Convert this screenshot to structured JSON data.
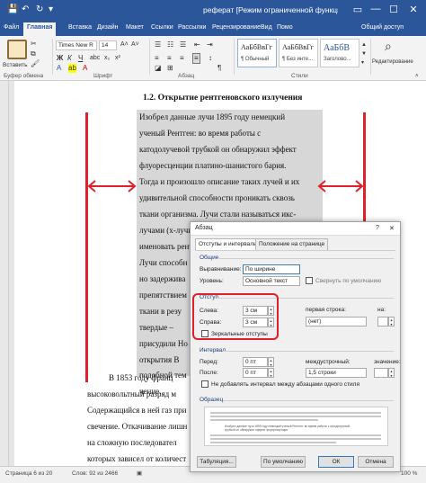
{
  "titlebar": {
    "title": "реферат [Режим ограниченной функциональност...",
    "qa_save": "💾",
    "qa_undo": "↶",
    "qa_redo": "↻",
    "qa_more": "▾",
    "win_restore": "▭",
    "win_minimize": "—",
    "win_maximize": "☐",
    "win_close": "✕"
  },
  "tabs": [
    "Файл",
    "Главная",
    "Вставка",
    "Дизайн",
    "Макет",
    "Ссылки",
    "Рассылки",
    "Рецензирование",
    "Вид"
  ],
  "tab_help": "Помо",
  "share": "Общий доступ",
  "ribbon": {
    "paste": "Вставить",
    "font_name": "Times New R",
    "font_size": "14",
    "bold": "Ж",
    "italic": "К",
    "underline": "Ч",
    "groups": {
      "clipboard": "Буфер обмена",
      "font": "Шрифт",
      "paragraph": "Абзац",
      "styles": "Стили",
      "editing": "Редактирование"
    },
    "styles": [
      {
        "sample": "АаБбВвГг",
        "name": "¶ Обычный"
      },
      {
        "sample": "АаБбВвГг",
        "name": "¶ Без инте..."
      },
      {
        "sample": "АаБбВ",
        "name": "Заголово..."
      }
    ],
    "editing": "Редактирование"
  },
  "document": {
    "heading": "1.2. Открытие рентгеновского излучения",
    "selected_lines": [
      "Изобрел данные лучи 1895 году немецкий",
      "ученый Рентген: во время работы с",
      "катодолучевой трубкой он обнаружил эффект",
      "флуоресценции платино-шанистого бария.",
      "Тогда и произошло описание таких лучей и их",
      "удивительной способности проникать сквозь",
      "ткани организма. Лучи стали называться икс-",
      "лучами (х-лучи). Позже в России их стали",
      "именовать рентгеновскими.",
      "Лучи способн",
      "но задержива",
      "препятствием",
      "ткани в резу",
      "твердые –",
      "присудили Но",
      "открытия В",
      "подобной тем",
      "чение."
    ],
    "after_lines": [
      "В 1853 году франц",
      "высоковольтный разряд м",
      "Содержащийся в ней газ при",
      "свечение. Откачивание лишн",
      "на сложную последовател",
      "которых зависел от количест"
    ]
  },
  "status": {
    "page": "Страница 6 из 20",
    "words": "Слов: 92 из 2466",
    "zoom": "100 %"
  },
  "dialog": {
    "title": "Абзац",
    "help": "?",
    "close": "✕",
    "tabs": [
      "Отступы и интервалы",
      "Положение на странице"
    ],
    "general": {
      "header": "Общие",
      "alignment_label": "Выравнивание:",
      "alignment_value": "По ширине",
      "level_label": "Уровень:",
      "level_value": "Основной текст",
      "collapse_label": "Свернуть по умолчанию"
    },
    "indent": {
      "header": "Отступ",
      "left_label": "Слева:",
      "left_value": "3 см",
      "right_label": "Справа:",
      "right_value": "3 см",
      "first_line_label": "первая строка:",
      "first_line_value": "(нет)",
      "on_label": "на:",
      "mirror_label": "Зеркальные отступы"
    },
    "spacing": {
      "header": "Интервал",
      "before_label": "Перед:",
      "before_value": "0 пт",
      "after_label": "После:",
      "after_value": "0 пт",
      "line_label": "междустрочный:",
      "line_value": "1,5 строки",
      "value_label": "значение:",
      "no_space_label": "Не добавлять интервал между абзацами одного стиля"
    },
    "sample": {
      "header": "Образец",
      "text": "Изобрел данные лучи 1895 году немецкий ученый Рентген: во время работы с катодолучевой трубкой он обнаружил эффект флуоресценции"
    },
    "buttons": {
      "tabs": "Табуляция...",
      "default": "По умолчанию",
      "ok": "ОК",
      "cancel": "Отмена"
    }
  },
  "colors": {
    "titlebar": "#2b579a",
    "annotation": "#e0202a",
    "selection": "#d7d7d7"
  }
}
